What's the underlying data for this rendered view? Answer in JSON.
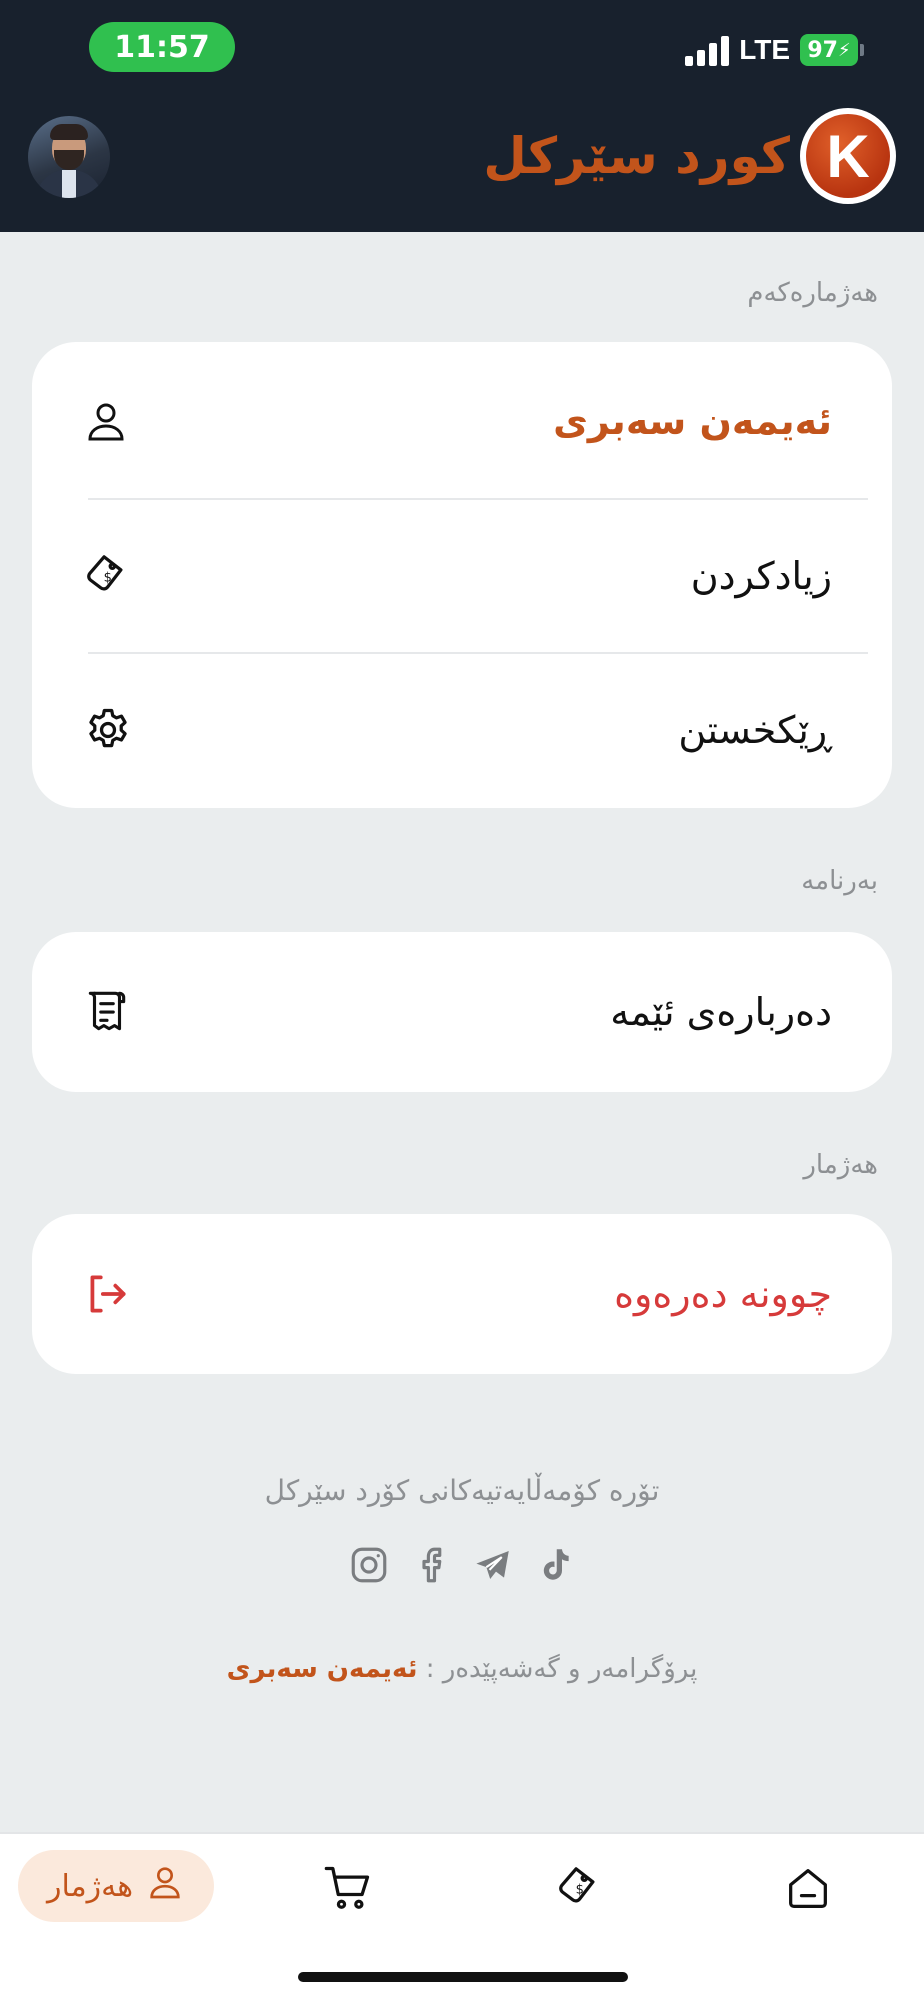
{
  "status_bar": {
    "time": "11:57",
    "network": "LTE",
    "battery": "97"
  },
  "header": {
    "brand_name": "كورد سێرکل",
    "logo_letter": "K",
    "brand_color": "#c2541b"
  },
  "account_section": {
    "label": "هەژمارەکەم",
    "items": [
      {
        "label": "ئەیمەن سەبری",
        "icon": "user-icon"
      },
      {
        "label": "زیادکردن",
        "icon": "price-tag-icon"
      },
      {
        "label": "ڕێکخستن",
        "icon": "gear-icon"
      }
    ]
  },
  "app_section": {
    "label": "بەرنامە",
    "items": [
      {
        "label": "دەربارەی ئێمە",
        "icon": "receipt-icon"
      }
    ]
  },
  "logout_section": {
    "label": "هەژمار",
    "items": [
      {
        "label": "چوونە دەرەوە",
        "icon": "logout-icon"
      }
    ]
  },
  "footer": {
    "social_title": "تۆرە کۆمەڵایەتیەکانی کۆرد سێرکل",
    "social_icons": [
      "instagram-icon",
      "facebook-icon",
      "telegram-icon",
      "tiktok-icon"
    ],
    "credit_prefix": "پرۆگرامەر و گەشەپێدەر :",
    "developer": "ئەیمەن سەبری"
  },
  "bottom_nav": {
    "active_label": "هەژمار",
    "items": [
      "account-tab",
      "cart-tab",
      "tag-tab",
      "home-tab"
    ]
  },
  "colors": {
    "header_bg": "#18212d",
    "accent": "#c2541b",
    "danger": "#d63a3a",
    "page_bg": "#eaedee"
  }
}
